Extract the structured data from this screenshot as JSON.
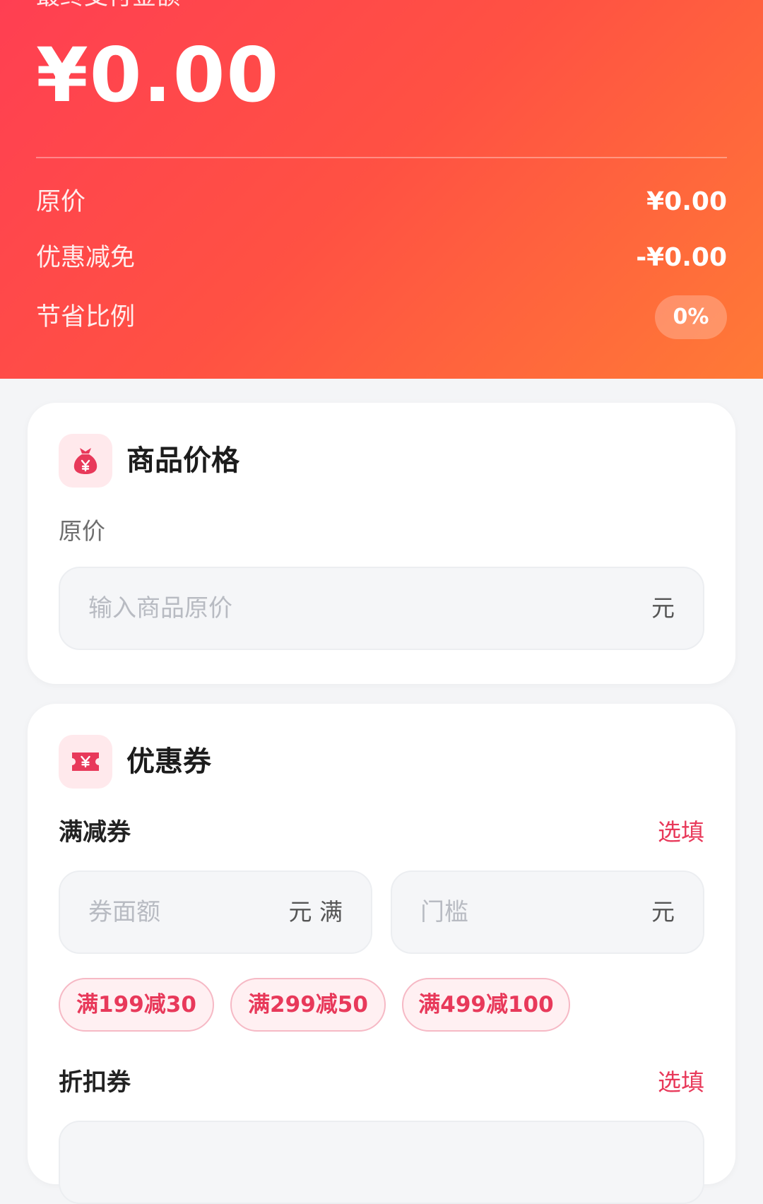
{
  "header": {
    "label": "最终支付金额",
    "final_amount": "¥0.00",
    "rows": [
      {
        "label": "原价",
        "value": "¥0.00"
      },
      {
        "label": "优惠减免",
        "value": "-¥0.00"
      },
      {
        "label": "节省比例",
        "value": "0%"
      }
    ]
  },
  "price_card": {
    "title": "商品价格",
    "icon": "money-bag-icon",
    "field_label": "原价",
    "input": {
      "placeholder": "输入商品原价",
      "value": "",
      "unit": "元"
    }
  },
  "coupon_card": {
    "title": "优惠券",
    "icon": "ticket-icon",
    "full_reduction": {
      "label": "满减券",
      "optional": "选填",
      "amount_input": {
        "placeholder": "券面额",
        "value": "",
        "unit": "元 满"
      },
      "threshold_input": {
        "placeholder": "门槛",
        "value": "",
        "unit": "元"
      },
      "presets": [
        "满199减30",
        "满299减50",
        "满499减100"
      ]
    },
    "discount": {
      "label": "折扣券",
      "optional": "选填"
    }
  },
  "colors": {
    "header_gradient_start": "#ff3f52",
    "header_gradient_end": "#ff7a36",
    "accent": "#e8395a",
    "page_background": "#f4f5f7"
  }
}
